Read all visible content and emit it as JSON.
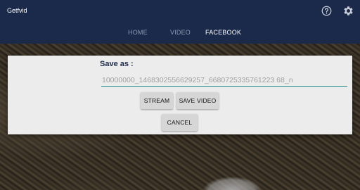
{
  "app": {
    "title": "Getfvid",
    "icons": {
      "help": "help-circle-icon",
      "settings": "gear-icon"
    }
  },
  "tabs": [
    {
      "label": "HOME",
      "active": false
    },
    {
      "label": "VIDEO",
      "active": false
    },
    {
      "label": "FACEBOOK",
      "active": true
    }
  ],
  "dialog": {
    "title": "Save as :",
    "filename_value": "10000000_1468302556629257_6680725335761223 68_n",
    "filename_placeholder": "",
    "stream_label": "STREAM",
    "save_video_label": "SAVE VIDEO",
    "cancel_label": "CANCEL"
  },
  "colors": {
    "appbar": "#1b2a4a",
    "accent_underline": "#1c8a8a",
    "dialog_bg": "#ececec",
    "tab_inactive": "#8d9bb5"
  }
}
